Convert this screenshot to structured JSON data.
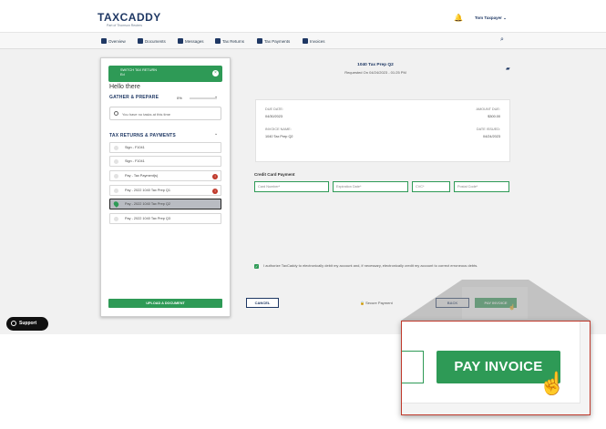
{
  "app": {
    "logo": "TAXCADDY",
    "logo_sub": "Part of Thomson Reuters",
    "user_name": "Tom Taxpayer ⌄"
  },
  "nav": [
    {
      "label": "Overview",
      "icon": "home-icon"
    },
    {
      "label": "Documents",
      "icon": "documents-icon"
    },
    {
      "label": "Messages",
      "icon": "messages-icon"
    },
    {
      "label": "Tax Returns",
      "icon": "tax-returns-icon"
    },
    {
      "label": "Tax Payments",
      "icon": "tax-payments-icon"
    },
    {
      "label": "Invoices",
      "icon": "invoices-icon"
    }
  ],
  "sidebar": {
    "switch_label": "SWITCH TAX RETURN",
    "switch_sub": "Ed",
    "greeting": "Hello there",
    "gather_title": "GATHER & PREPARE",
    "gather_pct": "0%",
    "no_tasks": "You have no tasks at this time",
    "returns_title": "TAX RETURNS & PAYMENTS",
    "items": [
      {
        "label": "Sign - F1041",
        "alert": ""
      },
      {
        "label": "Sign - F1041",
        "alert": ""
      },
      {
        "label": "Pay - Tax Payment(s)",
        "alert": "!"
      },
      {
        "label": "Pay - 2022 1040 Tax Prep Q1",
        "alert": "!"
      },
      {
        "label": "Pay - 2022 1040 Tax Prep Q2",
        "alert": ""
      },
      {
        "label": "Pay - 2022 1040 Tax Prep Q3",
        "alert": ""
      }
    ],
    "upload_label": "UPLOAD A DOCUMENT"
  },
  "main": {
    "title": "1040 Tax Prep Q2",
    "requested": "Requested On 04/24/2023 - 01:25 PM",
    "due_date_label": "DUE DATE:",
    "due_date": "04/30/2023",
    "amount_due_label": "AMOUNT DUE:",
    "amount_due": "$300.00",
    "invoice_name_label": "INVOICE NAME:",
    "invoice_name": "1040 Tax Prep Q2",
    "date_issued_label": "DATE ISSUED:",
    "date_issued": "04/24/2023",
    "cc_title": "Credit Card Payment",
    "card_number_ph": "Card Number*",
    "expiration_ph": "Expiration Date*",
    "cvc_ph": "CVC*",
    "postal_ph": "Postal Code*",
    "authorize_text": "I authorize TaxCaddy to electronically debit my account and, if necessary, electronically credit my account to correct erroneous debts.",
    "cancel_label": "CANCEL",
    "secure_label": "Secure Payment",
    "back_label": "BACK",
    "pay_label": "PAY INVOICE"
  },
  "support_label": "Support",
  "zoom": {
    "pay_label": "PAY INVOICE"
  }
}
